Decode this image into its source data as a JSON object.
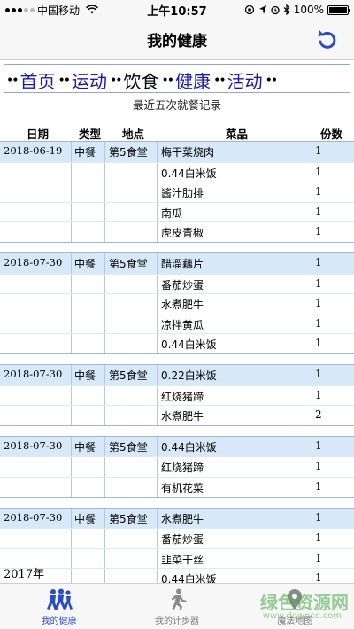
{
  "status": {
    "carrier": "中国移动",
    "time": "上午10:57",
    "battery_percent": "100%",
    "battery_level": 1.0
  },
  "nav": {
    "title": "我的健康",
    "refresh_icon": "refresh-icon"
  },
  "menu": {
    "items": [
      {
        "label": "首页",
        "current": false
      },
      {
        "label": "运动",
        "current": false
      },
      {
        "label": "饮食",
        "current": true
      },
      {
        "label": "健康",
        "current": false
      },
      {
        "label": "活动",
        "current": false
      }
    ]
  },
  "table": {
    "caption": "最近五次就餐记录",
    "headers": {
      "date": "日期",
      "type": "类型",
      "location": "地点",
      "dish": "菜品",
      "qty": "份数"
    },
    "records": [
      {
        "date": "2018-06-19",
        "type": "中餐",
        "location": "第5食堂",
        "items": [
          {
            "dish": "梅干菜烧肉",
            "qty": "1"
          },
          {
            "dish": "0.44白米饭",
            "qty": "1"
          },
          {
            "dish": "酱汁肋排",
            "qty": "1"
          },
          {
            "dish": "南瓜",
            "qty": "1"
          },
          {
            "dish": "虎皮青椒",
            "qty": "1"
          }
        ]
      },
      {
        "date": "2018-07-30",
        "type": "中餐",
        "location": "第5食堂",
        "items": [
          {
            "dish": "醋溜藕片",
            "qty": "1"
          },
          {
            "dish": "番茄炒蛋",
            "qty": "1"
          },
          {
            "dish": "水煮肥牛",
            "qty": "1"
          },
          {
            "dish": "凉拌黄瓜",
            "qty": "1"
          },
          {
            "dish": "0.44白米饭",
            "qty": "1"
          }
        ]
      },
      {
        "date": "2018-07-30",
        "type": "中餐",
        "location": "第5食堂",
        "items": [
          {
            "dish": "0.22白米饭",
            "qty": "1"
          },
          {
            "dish": "红烧猪蹄",
            "qty": "1"
          },
          {
            "dish": "水煮肥牛",
            "qty": "2"
          }
        ]
      },
      {
        "date": "2018-07-30",
        "type": "中餐",
        "location": "第5食堂",
        "items": [
          {
            "dish": "0.44白米饭",
            "qty": "1"
          },
          {
            "dish": "红烧猪蹄",
            "qty": "1"
          },
          {
            "dish": "有机花菜",
            "qty": "1"
          }
        ]
      },
      {
        "date": "2018-07-30",
        "type": "中餐",
        "location": "第5食堂",
        "items": [
          {
            "dish": "水煮肥牛",
            "qty": "1"
          },
          {
            "dish": "番茄炒蛋",
            "qty": "1"
          },
          {
            "dish": "韭菜干丝",
            "qty": "1"
          },
          {
            "dish": "0.44白米饭",
            "qty": "1"
          }
        ]
      }
    ],
    "year_label": "2017年"
  },
  "tabs": [
    {
      "label": "我的健康",
      "icon": "runners-group-icon",
      "active": true
    },
    {
      "label": "我的计步器",
      "icon": "runner-icon",
      "active": false
    },
    {
      "label": "魔法地图",
      "icon": "map-pin-icon",
      "active": false
    }
  ],
  "watermark": {
    "text": "绿色资源网",
    "url_text": "www.downcc.com"
  },
  "colors": {
    "accent": "#2a4ec0",
    "link": "#1a1aa6",
    "row_highlight": "#d7e9f8"
  }
}
